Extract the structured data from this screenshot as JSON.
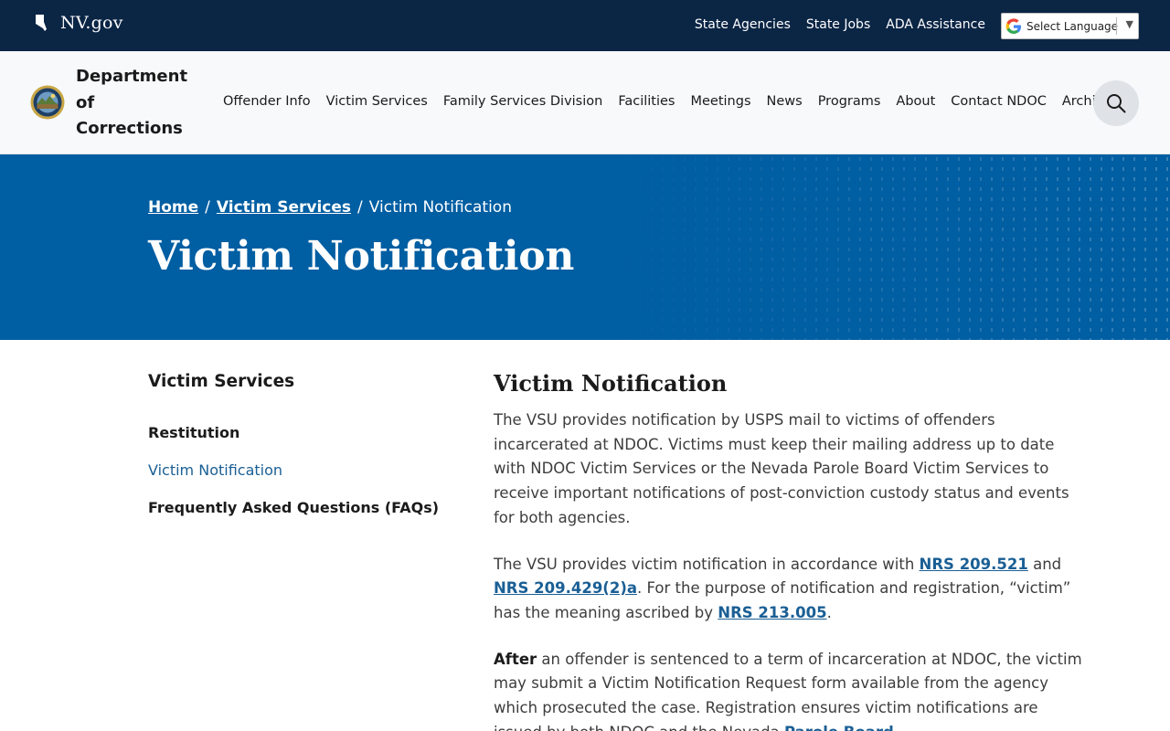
{
  "topbar": {
    "brand": "NV.gov",
    "links": [
      "State Agencies",
      "State Jobs",
      "ADA Assistance"
    ],
    "language_label": "Select Language"
  },
  "header": {
    "dept_line1": "Department",
    "dept_line2": "of",
    "dept_line3": "Corrections",
    "nav": [
      "Offender Info",
      "Victim Services",
      "Family Services Division",
      "Facilities",
      "Meetings",
      "News",
      "Programs",
      "About",
      "Contact NDOC",
      "Archive"
    ]
  },
  "hero": {
    "breadcrumb": [
      "Home",
      "Victim Services",
      "Victim Notification"
    ],
    "title": "Victim Notification"
  },
  "sidenav": {
    "title": "Victim Services",
    "items": [
      "Restitution",
      "Victim Notification",
      "Frequently Asked Questions (FAQs)"
    ]
  },
  "content": {
    "heading": "Victim Notification",
    "p1": "The VSU provides notification by USPS mail to victims of offenders incarcerated at NDOC. Victims must keep their mailing address up to date with NDOC Victim Services or the Nevada Parole Board Victim Services to receive important notifications of post-conviction custody status and events for both agencies.",
    "p2_a": "The VSU provides victim notification in accordance with ",
    "p2_link1": "NRS 209.521",
    "p2_b": " and ",
    "p2_link2": "NRS 209.429(2)a",
    "p2_c": ". For the purpose of notification and registration, “victim” has the meaning ascribed by ",
    "p2_link3": "NRS 213.005",
    "p2_d": ".",
    "p3_bold": "After",
    "p3_a": " an offender is sentenced to a term of incarceration at NDOC, the victim may submit a Victim Notification Request form available from the agency which prosecuted the case. Registration ensures victim notifications are issued by both NDOC and the Nevada ",
    "p3_link": "Parole Board",
    "p3_b": "."
  },
  "colors": {
    "topbar": "#0b2545",
    "hero": "#005ea2",
    "link": "#1a5f95"
  }
}
